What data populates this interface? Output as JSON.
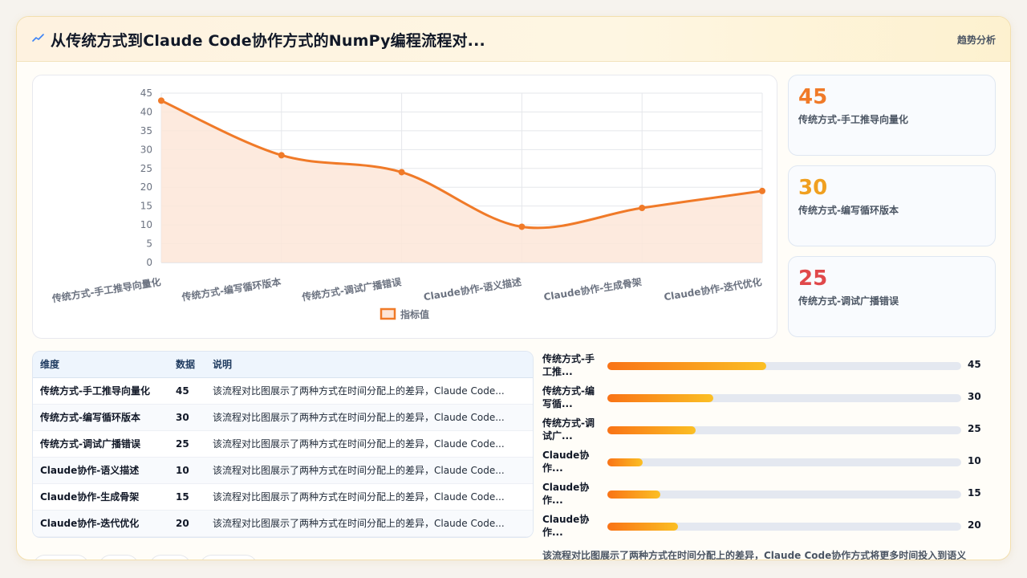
{
  "header": {
    "title": "从传统方式到Claude Code协作方式的NumPy编程流程对...",
    "tag": "趋势分析",
    "icon": "trend-line-icon"
  },
  "colors": {
    "accent": "#f07a28",
    "area_fill": "#fde6d8",
    "stat1": "#f07a28",
    "stat2": "#f0a020",
    "stat3": "#e0484a"
  },
  "stats": [
    {
      "value": "45",
      "label": "传统方式-手工推导向量化"
    },
    {
      "value": "30",
      "label": "传统方式-编写循环版本"
    },
    {
      "value": "25",
      "label": "传统方式-调试广播错误"
    }
  ],
  "table": {
    "headers": [
      "维度",
      "数据",
      "说明"
    ],
    "rows": [
      {
        "dim": "传统方式-手工推导向量化",
        "val": "45",
        "desc": "该流程对比图展示了两种方式在时间分配上的差异，Claude Code..."
      },
      {
        "dim": "传统方式-编写循环版本",
        "val": "30",
        "desc": "该流程对比图展示了两种方式在时间分配上的差异，Claude Code..."
      },
      {
        "dim": "传统方式-调试广播错误",
        "val": "25",
        "desc": "该流程对比图展示了两种方式在时间分配上的差异，Claude Code..."
      },
      {
        "dim": "Claude协作-语义描述",
        "val": "10",
        "desc": "该流程对比图展示了两种方式在时间分配上的差异，Claude Code..."
      },
      {
        "dim": "Claude协作-生成骨架",
        "val": "15",
        "desc": "该流程对比图展示了两种方式在时间分配上的差异，Claude Code..."
      },
      {
        "dim": "Claude协作-迭代优化",
        "val": "20",
        "desc": "该流程对比图展示了两种方式在时间分配上的差异，Claude Code..."
      }
    ]
  },
  "bars": [
    {
      "label": "传统方式-手工推...",
      "value": 45
    },
    {
      "label": "传统方式-编写循...",
      "value": 30
    },
    {
      "label": "传统方式-调试广...",
      "value": 25
    },
    {
      "label": "Claude协作...",
      "value": 10
    },
    {
      "label": "Claude协作...",
      "value": 15
    },
    {
      "label": "Claude协作...",
      "value": 20
    }
  ],
  "bars_max": 100,
  "footnote": "该流程对比图展示了两种方式在时间分配上的差异，Claude Code协作方式将更多时间投入到语义",
  "chart_data": {
    "type": "area",
    "categories": [
      "传统方式-手工推导向量化",
      "传统方式-编写循环版本",
      "传统方式-调试广播错误",
      "Claude协作-语义描述",
      "Claude协作-生成骨架",
      "Claude协作-迭代优化"
    ],
    "series": [
      {
        "name": "指标值",
        "values": [
          43,
          28.5,
          24,
          9.5,
          14.5,
          19
        ]
      }
    ],
    "ylim": [
      0,
      45
    ],
    "yticks": [
      0,
      5,
      10,
      15,
      20,
      25,
      30,
      35,
      40,
      45
    ],
    "grid": true,
    "legend": "bottom",
    "smooth": true
  }
}
